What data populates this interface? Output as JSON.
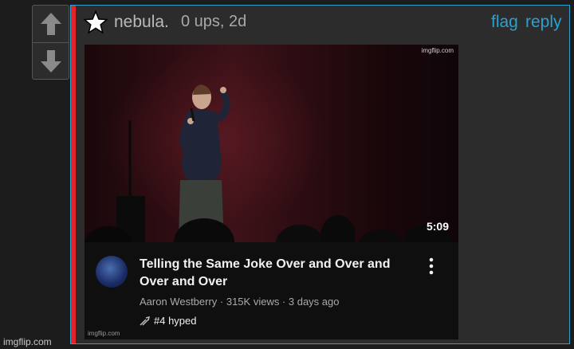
{
  "vote": {
    "up_icon": "arrow-up-icon",
    "down_icon": "arrow-down-icon"
  },
  "comment": {
    "username": "nebula.",
    "meta": "0 ups, 2d",
    "flag_label": "flag",
    "reply_label": "reply",
    "accent_color": "#2aa1d1",
    "bar_color": "#e2242a"
  },
  "meme": {
    "watermark_top": "imgflip.com",
    "duration": "5:09",
    "video_title": "Telling the Same Joke Over and Over and Over and Over",
    "channel_line": "Aaron Westberry · 315K views · 3 days ago",
    "hyped": "#4 hyped",
    "watermark_bottom": "imgflip.com"
  },
  "site_watermark": "imgflip.com"
}
